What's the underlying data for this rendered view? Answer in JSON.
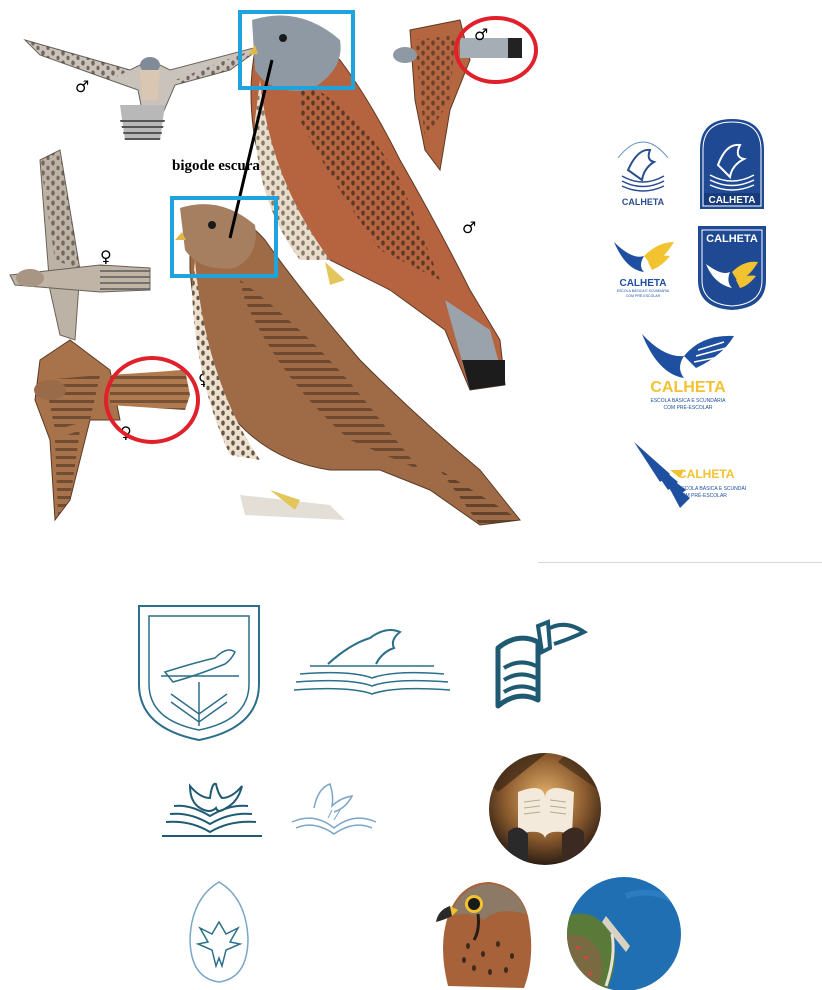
{
  "annotation": {
    "label": "bigode escura"
  },
  "symbols": {
    "male": "♂",
    "female": "♀"
  },
  "logos": {
    "school_name": "CALHETA",
    "school_subtitle_1": "ESCOLA BÁSICA E SCUNDÁRIA",
    "school_subtitle_2": "COM PRÉ-ESCOLAR",
    "arc_text": "ESCOLA BÁSICA E SECUNDÁRIA"
  },
  "colors": {
    "highlight_blue": "#1fa3dc",
    "highlight_red": "#e0202a",
    "brand_blue": "#1e4fa0",
    "brand_yellow": "#f2c230",
    "sketch_teal": "#2b6f8a",
    "kestrel_rufous": "#b0603c",
    "kestrel_grey": "#8f9aa4"
  }
}
